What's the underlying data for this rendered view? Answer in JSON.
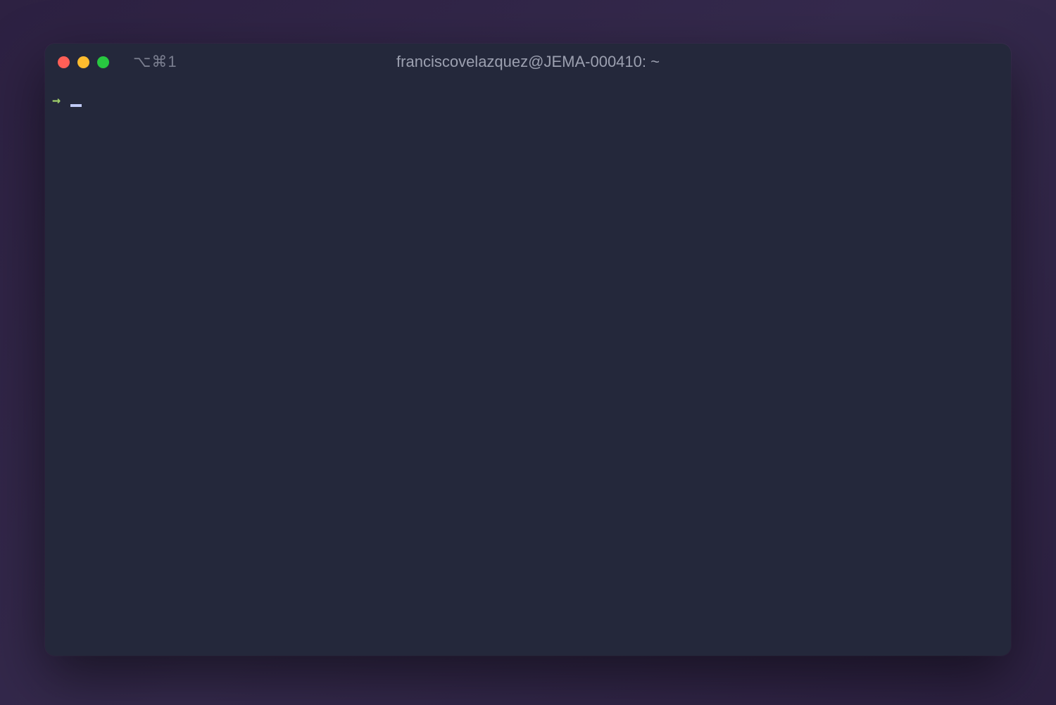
{
  "window": {
    "title": "franciscovelazquez@JEMA-000410: ~",
    "tab_indicator": "⌥⌘1"
  },
  "terminal": {
    "prompt_symbol": "→",
    "current_input": ""
  },
  "colors": {
    "background": "#24283b",
    "prompt": "#9ece6a",
    "text": "#c0caf5",
    "title": "#9ca0b0"
  }
}
